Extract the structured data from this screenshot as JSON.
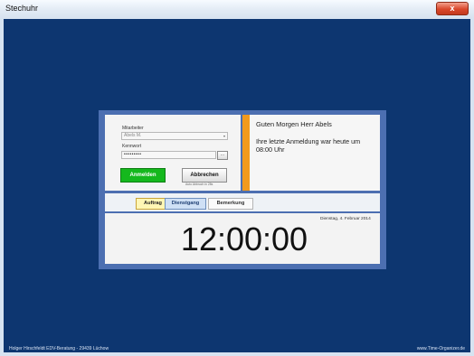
{
  "window": {
    "title": "Stechuhr",
    "close_label": "x"
  },
  "login": {
    "employee_label": "Mitarbeiter",
    "employee_value": "Abels M.",
    "password_label": "Kennwort",
    "password_value": "•••••••••",
    "ellipsis_label": "...",
    "login_button": "Anmelden",
    "cancel_button": "Abbrechen",
    "auto_cancel_note": "Auto Abbruch in 28s"
  },
  "greeting": {
    "title": "Guten Morgen Herr Abels",
    "line1": "Ihre letzte Anmeldung war heute um",
    "line2": "08:00 Uhr"
  },
  "tabs": [
    {
      "label": "Auftrag"
    },
    {
      "label": "Dienstgang"
    },
    {
      "label": "Bemerkung"
    }
  ],
  "clock": {
    "date": "Dienstag, 4. Februar 2014",
    "time": "12:00:00"
  },
  "footer": {
    "left": "Holger Hirschfeldt EDV-Beratung - 29439 Lüchow",
    "right": "www.Time-Organizer.de"
  },
  "colors": {
    "background": "#0d3670",
    "dialog_border": "#4c6fb1",
    "accent_orange": "#f29a1d",
    "login_green": "#15b81d"
  }
}
